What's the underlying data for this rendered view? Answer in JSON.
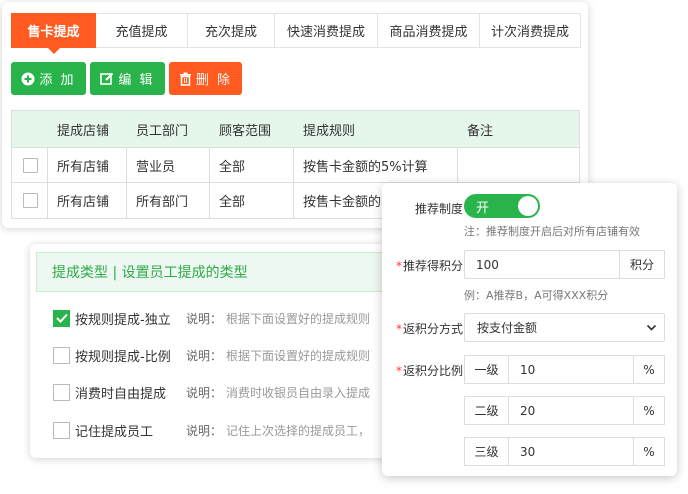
{
  "tabs": [
    "售卡提成",
    "充值提成",
    "充次提成",
    "快速消费提成",
    "商品消费提成",
    "计次消费提成"
  ],
  "toolbar": {
    "add_label": "添 加",
    "edit_label": "编 辑",
    "delete_label": "删 除"
  },
  "table": {
    "headers": [
      "提成店铺",
      "员工部门",
      "顾客范围",
      "提成规则",
      "备注"
    ],
    "rows": [
      [
        "所有店铺",
        "营业员",
        "全部",
        "按售卡金额的5%计算",
        ""
      ],
      [
        "所有店铺",
        "所有部门",
        "全部",
        "按售卡金额的",
        ""
      ]
    ]
  },
  "commission_type": {
    "header": "提成类型 | 设置员工提成的类型",
    "desc_label": "说明：",
    "options": [
      {
        "label": "按规则提成-独立",
        "checked": true,
        "desc": "根据下面设置好的提成规则"
      },
      {
        "label": "按规则提成-比例",
        "checked": false,
        "desc": "根据下面设置好的提成规则"
      },
      {
        "label": "消费时自由提成",
        "checked": false,
        "desc": "消费时收银员自由录入提成"
      },
      {
        "label": "记住提成员工",
        "checked": false,
        "desc": "记住上次选择的提成员工，"
      }
    ]
  },
  "referral": {
    "system_label": "推荐制度",
    "toggle_label": "开",
    "toggle_on": true,
    "system_hint": "注：推荐制度开启后对所有店铺有效",
    "points_label": "推荐得积分",
    "points_value": "100",
    "points_unit": "积分",
    "points_hint": "例：A推荐B，A可得XXX积分",
    "method_label": "返积分方式",
    "method_value": "按支付金额",
    "ratio_label": "返积分比例",
    "levels": [
      {
        "label": "一级",
        "value": "10",
        "unit": "%"
      },
      {
        "label": "二级",
        "value": "20",
        "unit": "%"
      },
      {
        "label": "三级",
        "value": "30",
        "unit": "%"
      }
    ]
  },
  "colors": {
    "brand_green": "#28b44b",
    "brand_orange": "#ff5a1f",
    "required_red": "#ff3b30"
  }
}
